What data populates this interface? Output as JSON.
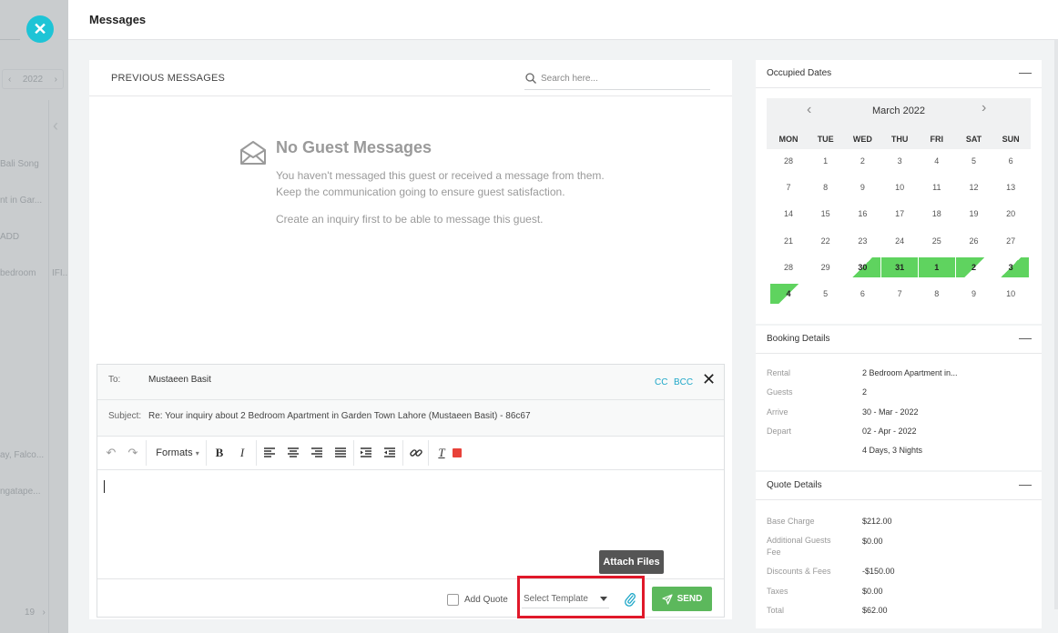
{
  "backdrop": {
    "year": "2022",
    "rows": [
      "Bali Song",
      "nt in Gar...",
      "ADD",
      "bedroom",
      "IFI...",
      "ay, Falco...",
      "ngatape..."
    ],
    "pager": "19"
  },
  "header": {
    "title": "Messages"
  },
  "messages": {
    "section_label": "PREVIOUS MESSAGES",
    "search_placeholder": "Search here...",
    "empty_title": "No Guest Messages",
    "empty_line1": "You haven't messaged this guest or received a message from them.",
    "empty_line2": "Keep the communication going to ensure guest satisfaction.",
    "empty_line3": "Create an inquiry first to be able to message this guest."
  },
  "composer": {
    "to_label": "To:",
    "to_value": "Mustaeen Basit",
    "cc_label": "CC",
    "bcc_label": "BCC",
    "subject_label": "Subject:",
    "subject_value": "Re: Your inquiry about 2 Bedroom Apartment in Garden Town Lahore (Mustaeen Basit) - 86c67",
    "formats_label": "Formats",
    "add_quote_label": "Add Quote",
    "template_placeholder": "Select Template",
    "send_label": "SEND",
    "attach_tooltip": "Attach Files"
  },
  "occupied": {
    "title": "Occupied Dates",
    "month": "March 2022",
    "weekdays": [
      "MON",
      "TUE",
      "WED",
      "THU",
      "FRI",
      "SAT",
      "SUN"
    ],
    "weeks": [
      [
        "28",
        "1",
        "2",
        "3",
        "4",
        "5",
        "6"
      ],
      [
        "7",
        "8",
        "9",
        "10",
        "11",
        "12",
        "13"
      ],
      [
        "14",
        "15",
        "16",
        "17",
        "18",
        "19",
        "20"
      ],
      [
        "21",
        "22",
        "23",
        "24",
        "25",
        "26",
        "27"
      ],
      [
        "28",
        "29",
        "30",
        "31",
        "1",
        "2",
        "3"
      ],
      [
        "4",
        "5",
        "6",
        "7",
        "8",
        "9",
        "10"
      ]
    ],
    "occupied_color": "#5fd35f"
  },
  "booking": {
    "title": "Booking Details",
    "rows": [
      {
        "label": "Rental",
        "value": "2 Bedroom Apartment in..."
      },
      {
        "label": "Guests",
        "value": "2"
      },
      {
        "label": "Arrive",
        "value": "30 - Mar - 2022"
      },
      {
        "label": "Depart",
        "value": "02 - Apr - 2022"
      },
      {
        "label": "",
        "value": "4 Days, 3 Nights"
      }
    ]
  },
  "quote": {
    "title": "Quote Details",
    "rows": [
      {
        "label": "Base Charge",
        "value": "$212.00"
      },
      {
        "label": "Additional Guests Fee",
        "value": "$0.00"
      },
      {
        "label": "Discounts & Fees",
        "value": "-$150.00"
      },
      {
        "label": "Taxes",
        "value": "$0.00"
      },
      {
        "label": "Total",
        "value": "$62.00"
      }
    ]
  },
  "colors": {
    "accent_cyan": "#1ec4d6",
    "send_green": "#5cb85c",
    "highlight_red": "#e0182a"
  }
}
